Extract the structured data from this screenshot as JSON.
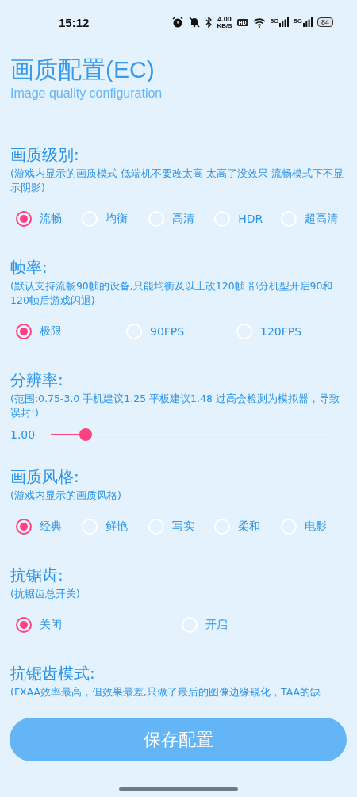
{
  "status_bar": {
    "time": "15:12",
    "net_speed": "4.00",
    "net_unit": "KB/S",
    "hd": "HD",
    "sim1": "5G",
    "sim2": "5G",
    "battery": "84"
  },
  "title": "画质配置(EC)",
  "subtitle": "Image quality configuration",
  "sections": [
    {
      "kind": "radio",
      "heading": "画质级别:",
      "description": "(游戏内显示的画质模式 低端机不要改太高 太高了没效果 流畅模式下不显示阴影)",
      "options": [
        {
          "label": "流畅",
          "selected": true
        },
        {
          "label": "均衡",
          "selected": false
        },
        {
          "label": "高清",
          "selected": false
        },
        {
          "label": "HDR",
          "selected": false
        },
        {
          "label": "超高清",
          "selected": false
        }
      ]
    },
    {
      "kind": "radio",
      "heading": "帧率:",
      "description": "(默认支持流畅90帧的设备,只能均衡及以上改120帧  部分机型开启90和120帧后游戏闪退)",
      "options": [
        {
          "label": "极限",
          "selected": true
        },
        {
          "label": "90FPS",
          "selected": false
        },
        {
          "label": "120FPS",
          "selected": false
        }
      ]
    },
    {
      "kind": "slider",
      "heading": "分辨率:",
      "description": "(范围:0.75-3.0  手机建议1.25 平板建议1.48  过高会检测为模拟器，导致误封!)",
      "value": "1.00",
      "level": 0.11
    },
    {
      "kind": "radio",
      "heading": "画质风格:",
      "description": "(游戏内显示的画质风格)",
      "options": [
        {
          "label": "经典",
          "selected": true
        },
        {
          "label": "鲜艳",
          "selected": false
        },
        {
          "label": "写实",
          "selected": false
        },
        {
          "label": "柔和",
          "selected": false
        },
        {
          "label": "电影",
          "selected": false
        }
      ]
    },
    {
      "kind": "radio",
      "heading": "抗锯齿:",
      "description": "(抗锯齿总开关)",
      "options": [
        {
          "label": "关闭",
          "selected": true
        },
        {
          "label": "开启",
          "selected": false
        }
      ]
    },
    {
      "kind": "text",
      "heading": "抗锯齿模式:",
      "description": "(FXAA效率最高，但效果最差,只做了最后的图像边缘锐化，TAA的缺"
    }
  ],
  "save_button": "保存配置"
}
